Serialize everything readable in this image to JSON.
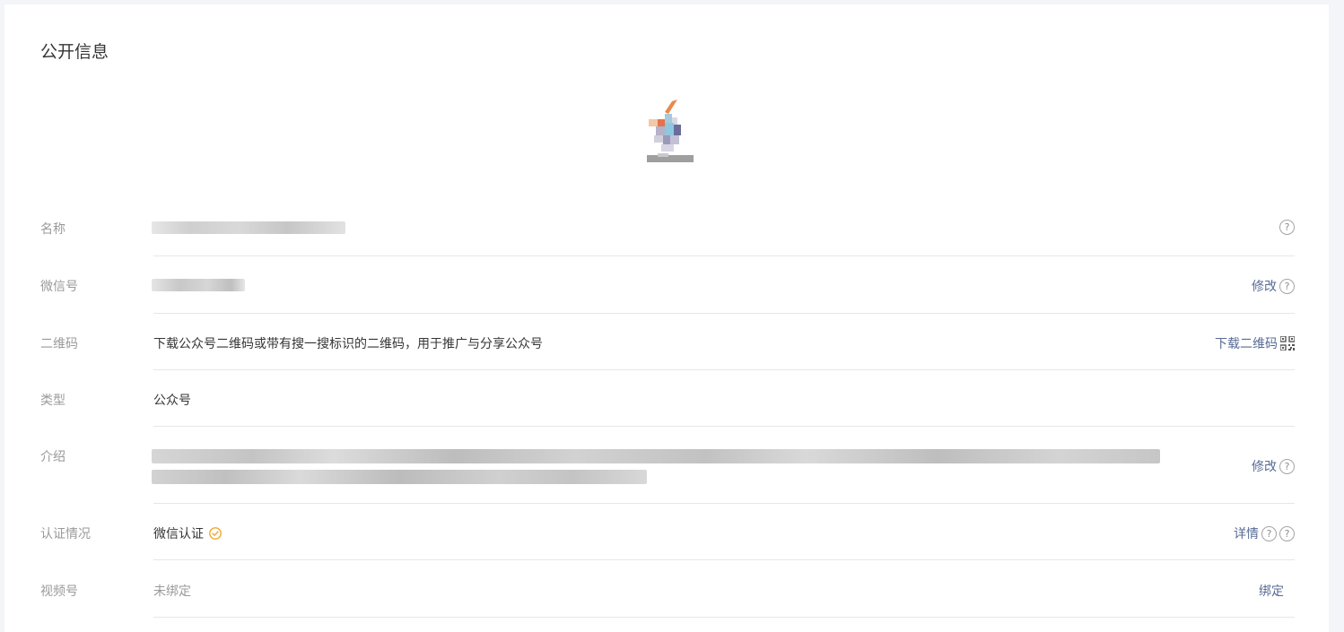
{
  "section_title": "公开信息",
  "rows": {
    "name": {
      "label": "名称"
    },
    "wechat_id": {
      "label": "微信号",
      "action": "修改"
    },
    "qrcode": {
      "label": "二维码",
      "value": "下载公众号二维码或带有搜一搜标识的二维码，用于推广与分享公众号",
      "action": "下载二维码"
    },
    "type": {
      "label": "类型",
      "value": "公众号"
    },
    "intro": {
      "label": "介绍",
      "action": "修改"
    },
    "verification": {
      "label": "认证情况",
      "value": "微信认证",
      "action": "详情"
    },
    "channels": {
      "label": "视频号",
      "value": "未绑定",
      "action": "绑定"
    }
  },
  "icons": {
    "help": "question-circle-icon",
    "qrcode": "qrcode-icon",
    "verified": "verified-check-icon"
  },
  "colors": {
    "link": "#576b95",
    "verified": "#f0a732",
    "label": "#9a9a9a",
    "text": "#353535",
    "divider": "#e7e7eb"
  }
}
